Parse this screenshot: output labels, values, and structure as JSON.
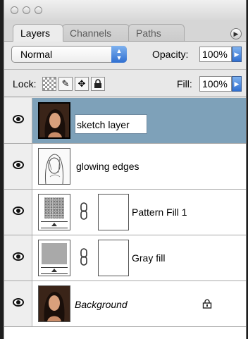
{
  "tabs": [
    {
      "label": "Layers",
      "active": true
    },
    {
      "label": "Channels",
      "active": false
    },
    {
      "label": "Paths",
      "active": false
    }
  ],
  "blend_mode": "Normal",
  "opacity": {
    "label": "Opacity:",
    "value": "100%"
  },
  "lock": {
    "label": "Lock:"
  },
  "fill": {
    "label": "Fill:",
    "value": "100%"
  },
  "layers": [
    {
      "name": "sketch layer",
      "selected": true,
      "visible": true,
      "thumb": "photo"
    },
    {
      "name": "glowing edges",
      "selected": false,
      "visible": true,
      "thumb": "sketch"
    },
    {
      "name": "Pattern Fill 1",
      "selected": false,
      "visible": true,
      "thumb": "pattern",
      "has_mask": true
    },
    {
      "name": "Gray fill",
      "selected": false,
      "visible": true,
      "thumb": "gray",
      "has_mask": true
    },
    {
      "name": "Background",
      "selected": false,
      "visible": true,
      "thumb": "photo",
      "locked": true
    }
  ],
  "colors": {
    "selection": "#7ea1b9",
    "accent_blue": "#2f6fd1"
  }
}
